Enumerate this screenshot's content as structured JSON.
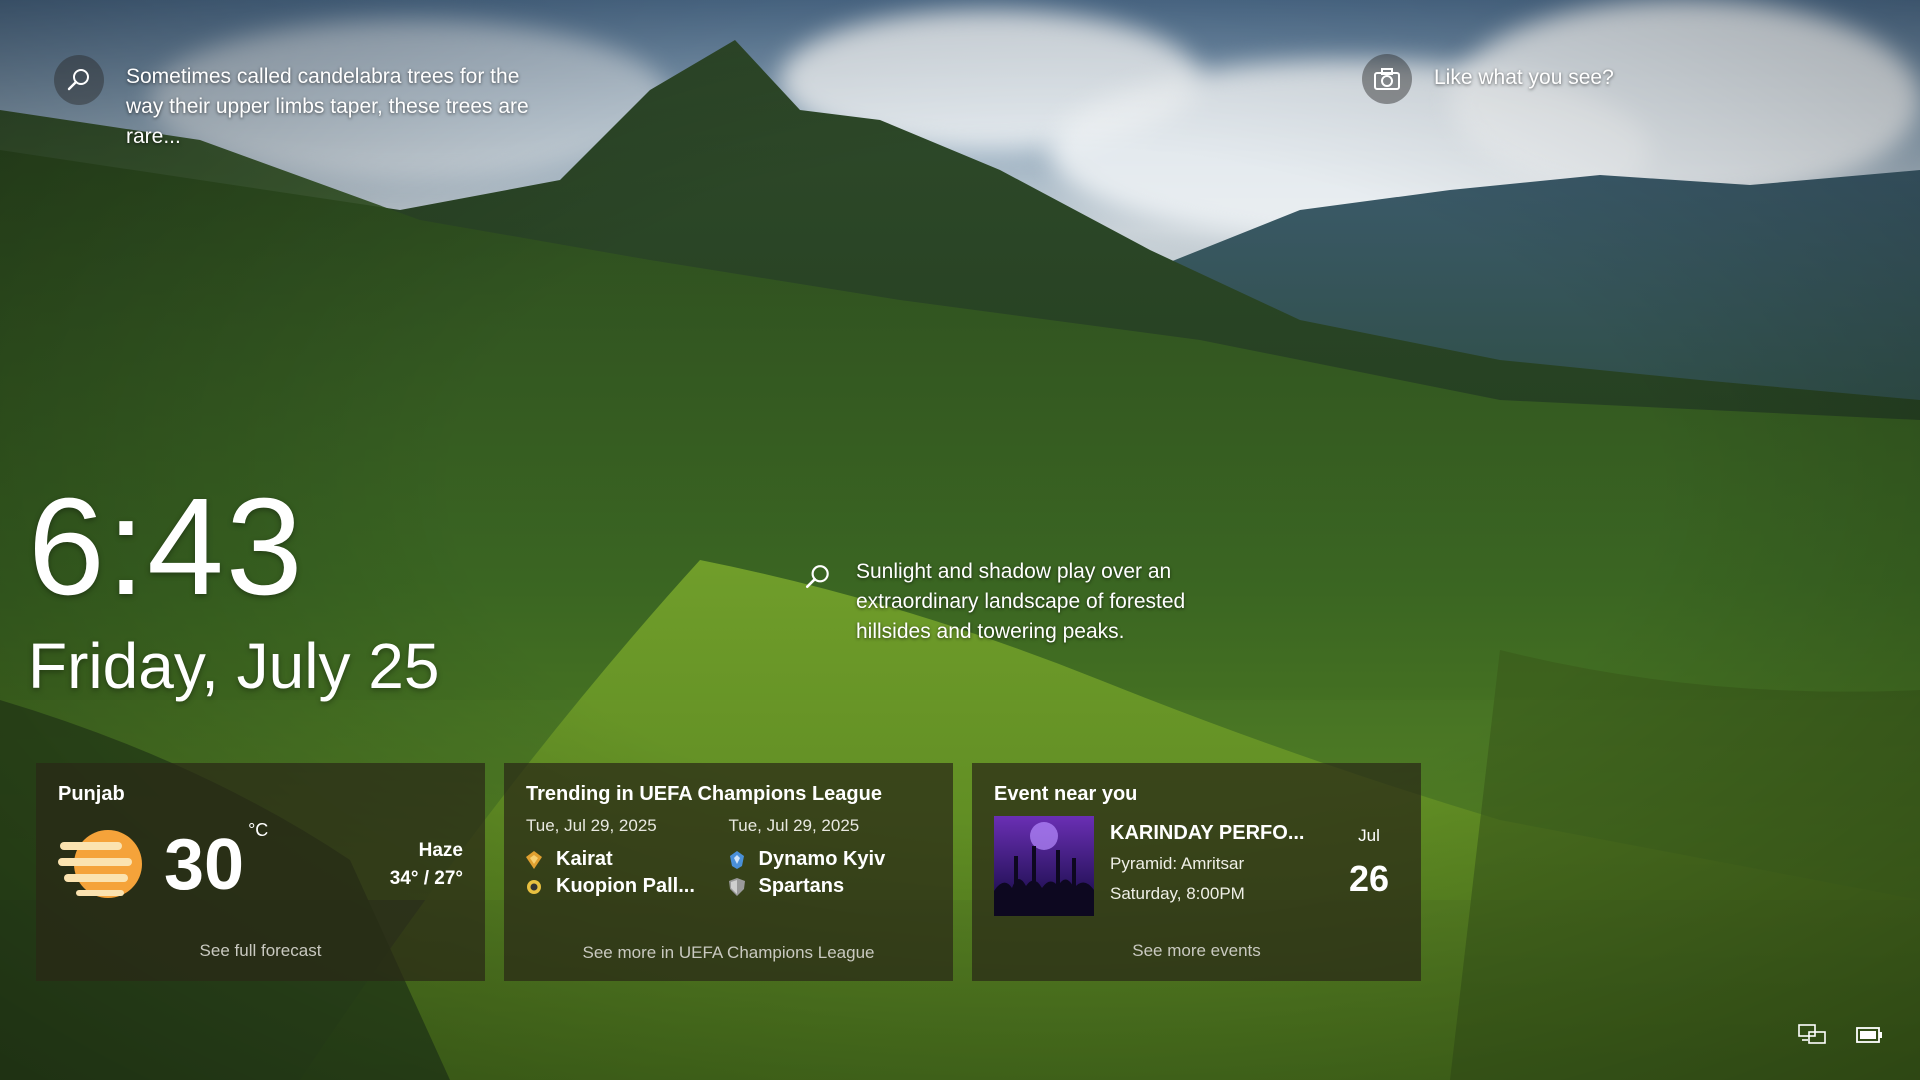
{
  "hotspots": {
    "top_left": {
      "icon": "search-icon",
      "text": "Sometimes called candelabra trees for the way their upper limbs taper, these trees are rare..."
    },
    "center": {
      "icon": "search-icon",
      "text": "Sunlight and shadow play over an extraordinary landscape of forested hillsides and towering peaks."
    },
    "top_right": {
      "icon": "camera-icon",
      "text": "Like what you see?"
    }
  },
  "clock": {
    "time": "6:43",
    "date": "Friday, July 25"
  },
  "weather": {
    "location": "Punjab",
    "temperature": "30",
    "unit": "°C",
    "condition": "Haze",
    "high_low": "34° / 27°",
    "link": "See full forecast",
    "icon": "haze-sun-icon"
  },
  "trending": {
    "title": "Trending in UEFA Champions League",
    "matches": [
      {
        "date": "Tue, Jul 29, 2025",
        "team1": "Kairat",
        "team2": "Kuopion Pall..."
      },
      {
        "date": "Tue, Jul 29, 2025",
        "team1": "Dynamo Kyiv",
        "team2": "Spartans"
      }
    ],
    "link": "See more in UEFA Champions League"
  },
  "event": {
    "title": "Event near you",
    "name": "KARINDAY PERFO...",
    "venue": "Pyramid: Amritsar",
    "time": "Saturday, 8:00PM",
    "month": "Jul",
    "day": "26",
    "link": "See more events"
  },
  "colors": {
    "card_bg": "#2a2816",
    "link": "#c9c9c0",
    "weather_sun": "#f5a33a"
  }
}
